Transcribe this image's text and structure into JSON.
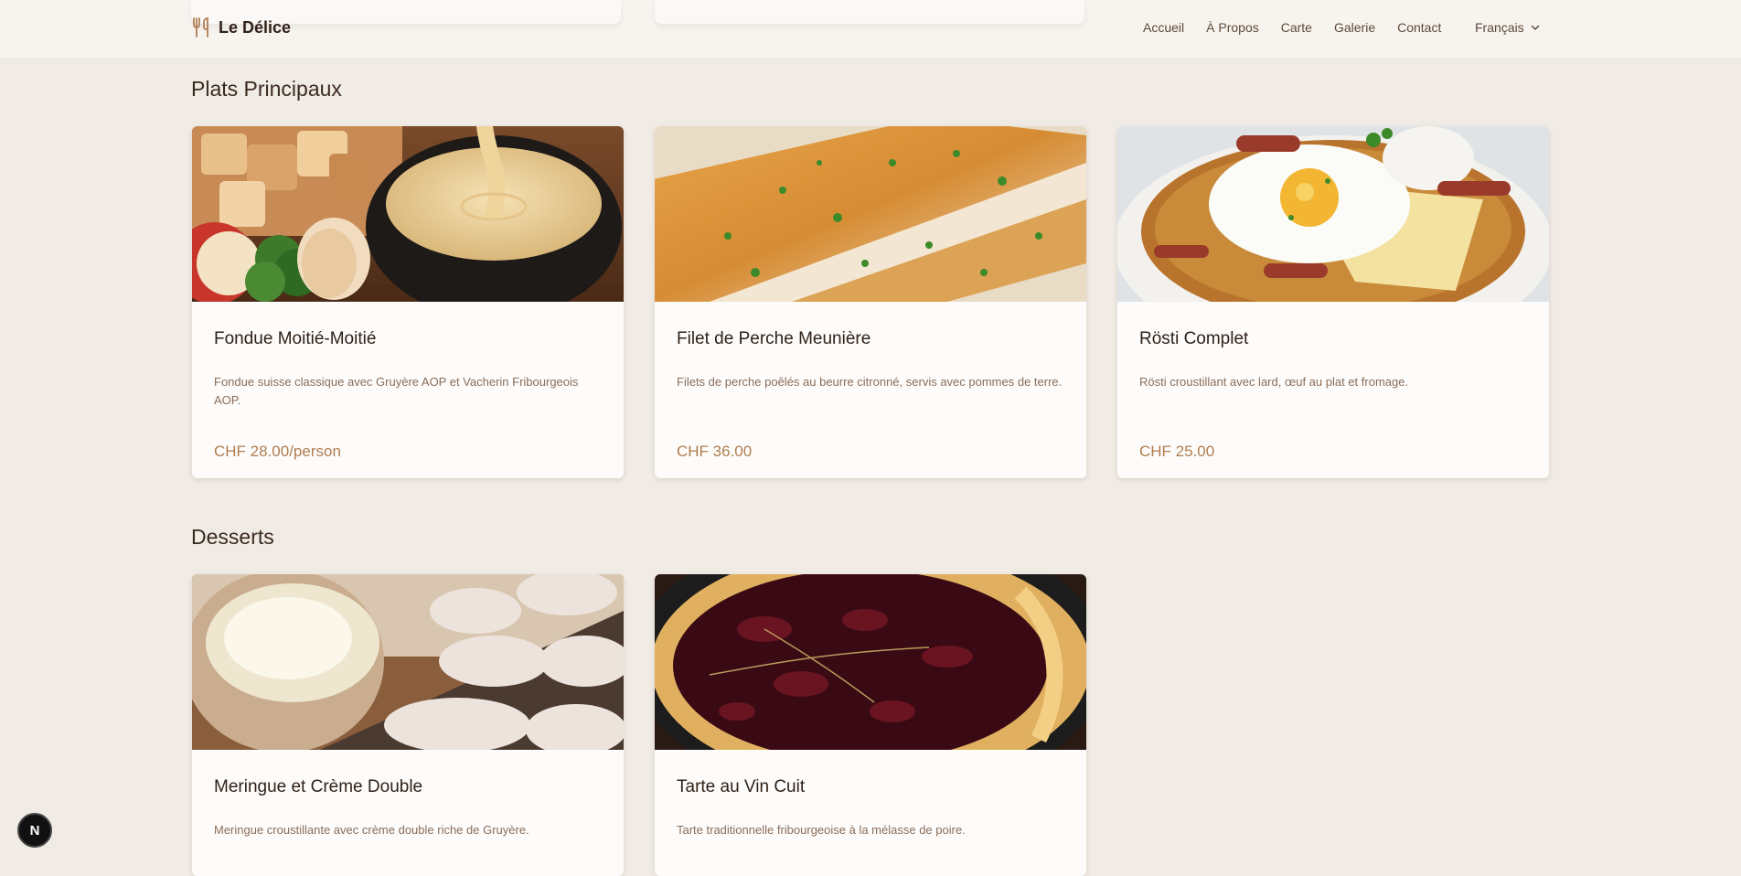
{
  "brand": {
    "name": "Le Délice"
  },
  "nav": {
    "items": [
      "Accueil",
      "À Propos",
      "Carte",
      "Galerie",
      "Contact"
    ],
    "language": "Français"
  },
  "sections": [
    {
      "title": "Plats Principaux",
      "items": [
        {
          "name": "Fondue Moitié-Moitié",
          "description": "Fondue suisse classique avec Gruyère AOP et Vacherin Fribourgeois AOP.",
          "price": "CHF 28.00/person"
        },
        {
          "name": "Filet de Perche Meunière",
          "description": "Filets de perche poêlés au beurre citronné, servis avec pommes de terre.",
          "price": "CHF 36.00"
        },
        {
          "name": "Rösti Complet",
          "description": "Rösti croustillant avec lard, œuf au plat et fromage.",
          "price": "CHF 25.00"
        }
      ]
    },
    {
      "title": "Desserts",
      "items": [
        {
          "name": "Meringue et Crème Double",
          "description": "Meringue croustillante avec crème double riche de Gruyère."
        },
        {
          "name": "Tarte au Vin Cuit",
          "description": "Tarte traditionnelle fribourgeoise à la mélasse de poire."
        }
      ]
    }
  ],
  "dev_badge": {
    "label": "N"
  },
  "colors": {
    "background": "#f1ebe5",
    "accent": "#b07d4f",
    "card": "#fdfcfb"
  }
}
